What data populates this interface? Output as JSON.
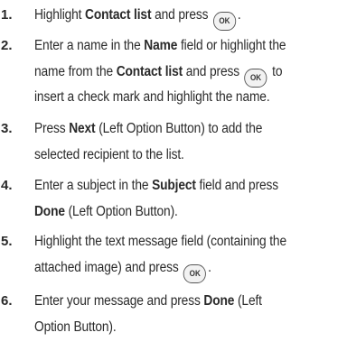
{
  "ok_button": {
    "label": "OK"
  },
  "steps": [
    {
      "num": "1.",
      "l1": {
        "t0": "Highlight ",
        "b0": "Contact list",
        "t1": " and press ",
        "end": "."
      }
    },
    {
      "num": "2.",
      "l1": {
        "t0": "Enter a name in the ",
        "b0": "Name",
        "t1": " field or highlight the"
      },
      "l2": {
        "t0": "name from the ",
        "b0": "Contact list",
        "t1": " and press ",
        "t2": " to"
      },
      "l3": {
        "t0": "insert a check mark and highlight the name."
      }
    },
    {
      "num": "3.",
      "l1": {
        "t0": "Press ",
        "b0": "Next",
        "t1": " (Left Option Button) to add the"
      },
      "l2": {
        "t0": "selected recipient to the list."
      }
    },
    {
      "num": "4.",
      "l1": {
        "t0": "Enter a subject in the ",
        "b0": "Subject",
        "t1": " field and press"
      },
      "l2": {
        "b0": "Done",
        "t0": " (Left Option Button)."
      }
    },
    {
      "num": "5.",
      "l1": {
        "t0": "Highlight the text message field (containing the"
      },
      "l2": {
        "t0": "attached image) and press ",
        "end": "."
      }
    },
    {
      "num": "6.",
      "l1": {
        "t0": "Enter your message and press ",
        "b0": "Done",
        "t1": " (Left"
      },
      "l2": {
        "t0": "Option Button)."
      }
    }
  ]
}
